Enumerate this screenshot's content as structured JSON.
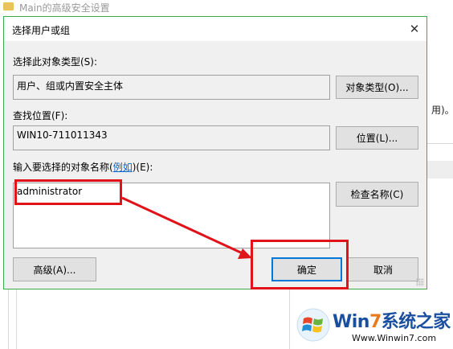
{
  "background_window": {
    "title": "Main的高级安全设置",
    "right_text": "用)。"
  },
  "dialog": {
    "title": "选择用户或组",
    "object_type_label": "选择此对象类型(S):",
    "object_type_value": "用户、组或内置安全主体",
    "object_types_button": "对象类型(O)...",
    "location_label": "查找位置(F):",
    "location_value": "WIN10-711011343",
    "locations_button": "位置(L)...",
    "names_label_prefix": "输入要选择的对象名称(",
    "names_label_link": "例如",
    "names_label_suffix": ")(E):",
    "names_value": "administrator",
    "check_names_button": "检查名称(C)",
    "advanced_button": "高级(A)...",
    "ok_button": "确定",
    "cancel_button": "取消"
  },
  "annotations": {
    "color": "#e0131a"
  },
  "watermark": {
    "brand_prefix": "Win",
    "brand_seven": "7",
    "brand_suffix": "系统之家",
    "url": "Www.Winwin7.com"
  }
}
